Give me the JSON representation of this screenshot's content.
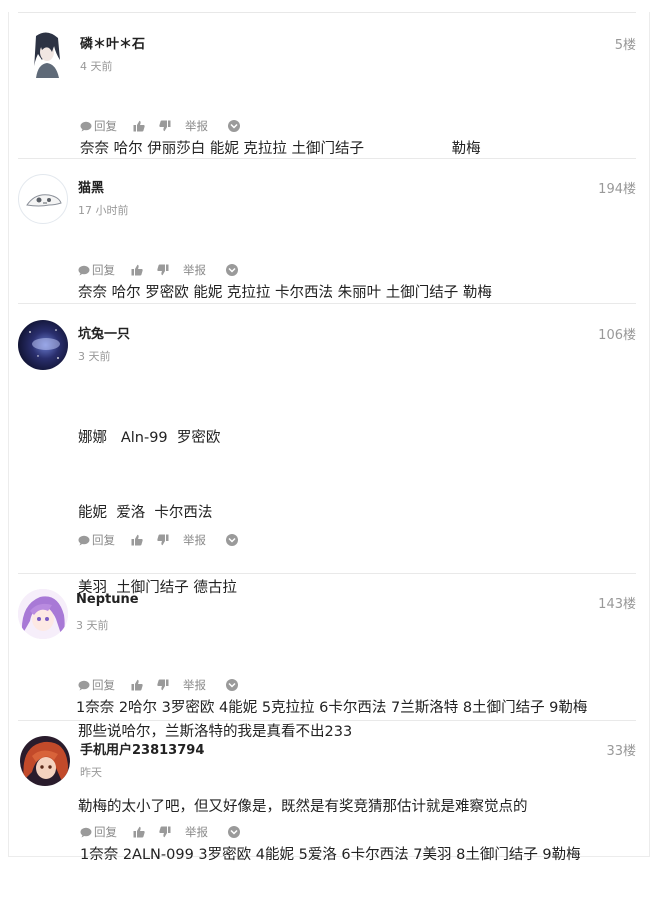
{
  "labels": {
    "reply": "回复",
    "report": "举报"
  },
  "comments": [
    {
      "name": "磷＊叶＊石",
      "time": "4 天前",
      "floor": "5楼",
      "lines": [
        "奈奈 哈尔 伊丽莎白 能妮 克拉拉 土御门结子                   勒梅"
      ],
      "avatar": "avatar-dark-haired-character"
    },
    {
      "name": "猫黑",
      "time": "17 小时前",
      "floor": "194楼",
      "lines": [
        "奈奈 哈尔 罗密欧 能妮 克拉拉 卡尔西法 朱丽叶 土御门结子 勒梅"
      ],
      "avatar": "avatar-white-sketch"
    },
    {
      "name": "坑兔一只",
      "time": "3 天前",
      "floor": "106楼",
      "lines": [
        "娜娜   Aln-99  罗密欧",
        "能妮  爱洛  卡尔西法",
        "美羽  土御门结子 德古拉",
        "",
        "那些说哈尔，兰斯洛特的我是真看不出233",
        "勒梅的太小了吧，但又好像是，既然是有奖竞猜那估计就是难察觉点的"
      ],
      "avatar": "avatar-night-sky"
    },
    {
      "name": "Neptune",
      "time": "3 天前",
      "floor": "143楼",
      "lines": [
        "1奈奈 2哈尔 3罗密欧 4能妮 5克拉拉 6卡尔西法 7兰斯洛特 8土御门结子 9勒梅"
      ],
      "avatar": "avatar-purple-hair"
    },
    {
      "name": "手机用户23813794",
      "time": "昨天",
      "floor": "33楼",
      "lines": [
        "1奈奈 2ALN-099 3罗密欧 4能妮 5爱洛 6卡尔西法 7美羽 8土御门结子 9勒梅"
      ],
      "avatar": "avatar-red-hair"
    }
  ]
}
